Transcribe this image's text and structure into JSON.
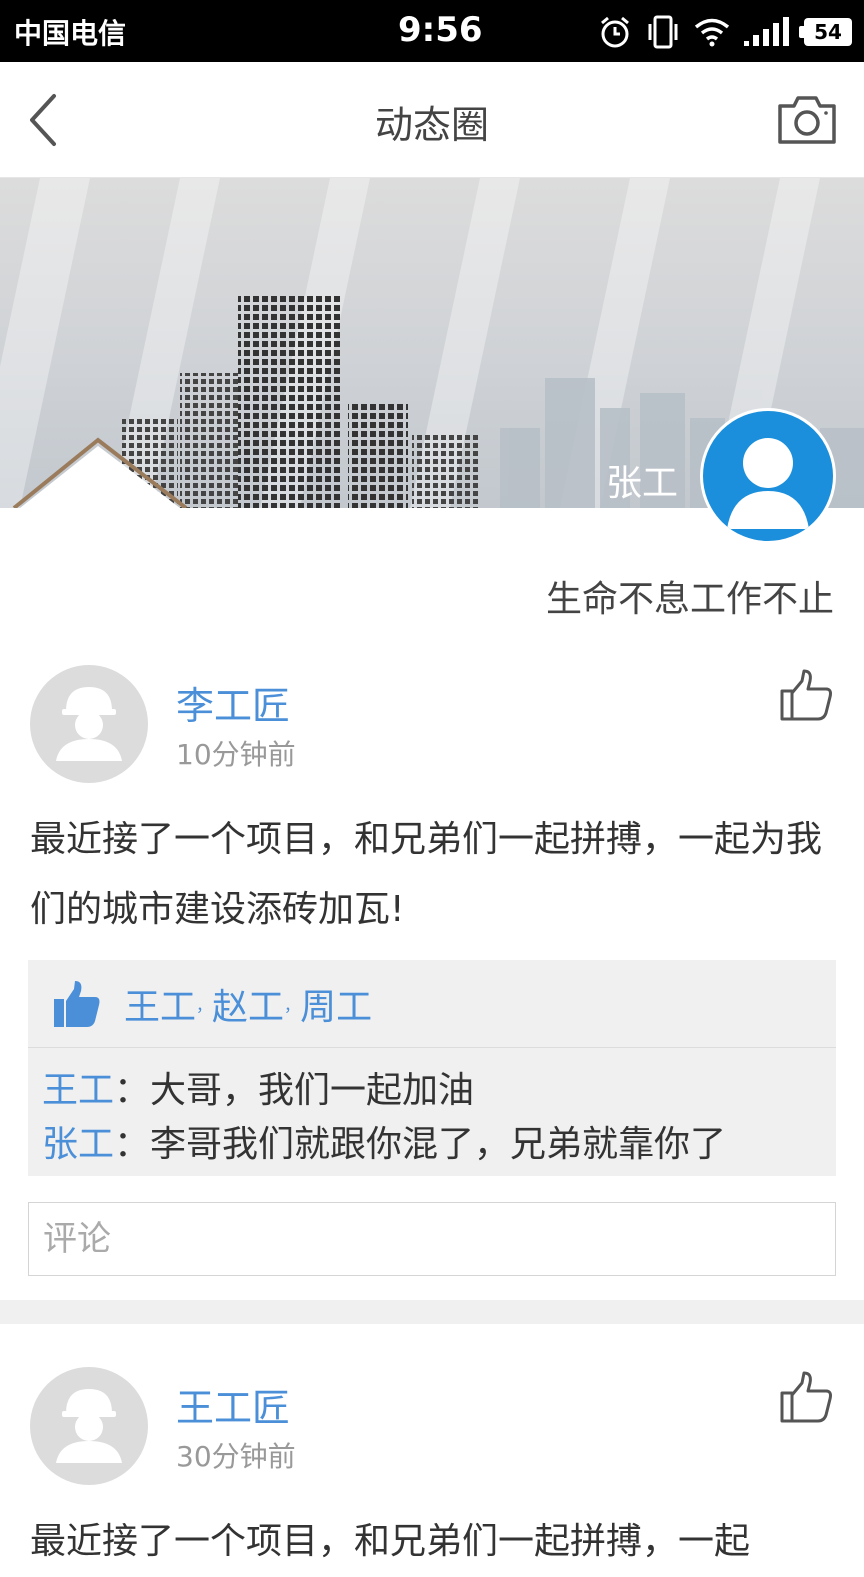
{
  "status_bar": {
    "carrier": "中国电信",
    "time": "9:56",
    "battery": "54"
  },
  "nav": {
    "title": "动态圈"
  },
  "profile": {
    "name": "张工",
    "motto": "生命不息工作不止"
  },
  "posts": [
    {
      "author": "李工匠",
      "time": "10分钟前",
      "text": "最近接了一个项目，和兄弟们一起拼搏，一起为我们的城市建设添砖加瓦!",
      "likes": [
        "王工",
        "赵工",
        "周工"
      ],
      "like_separator": "，",
      "comments": [
        {
          "author": "王工",
          "colon": "：",
          "text": "大哥，我们一起加油"
        },
        {
          "author": "张工",
          "colon": "：",
          "text": "李哥我们就跟你混了，兄弟就靠你了"
        }
      ],
      "comment_placeholder": "评论"
    },
    {
      "author": "王工匠",
      "time": "30分钟前",
      "text": "最近接了一个项目，和兄弟们一起拼搏，一起"
    }
  ],
  "colors": {
    "link_blue": "#4a8fd8",
    "avatar_blue": "#1b8fdb",
    "panel_gray": "#f0f0f0"
  },
  "icons": [
    "back-arrow-icon",
    "camera-icon",
    "user-avatar-icon",
    "worker-avatar-icon",
    "thumbs-up-outline-icon",
    "thumbs-up-filled-icon",
    "alarm-icon",
    "vibrate-icon",
    "wifi-icon",
    "signal-icon",
    "battery-icon"
  ]
}
